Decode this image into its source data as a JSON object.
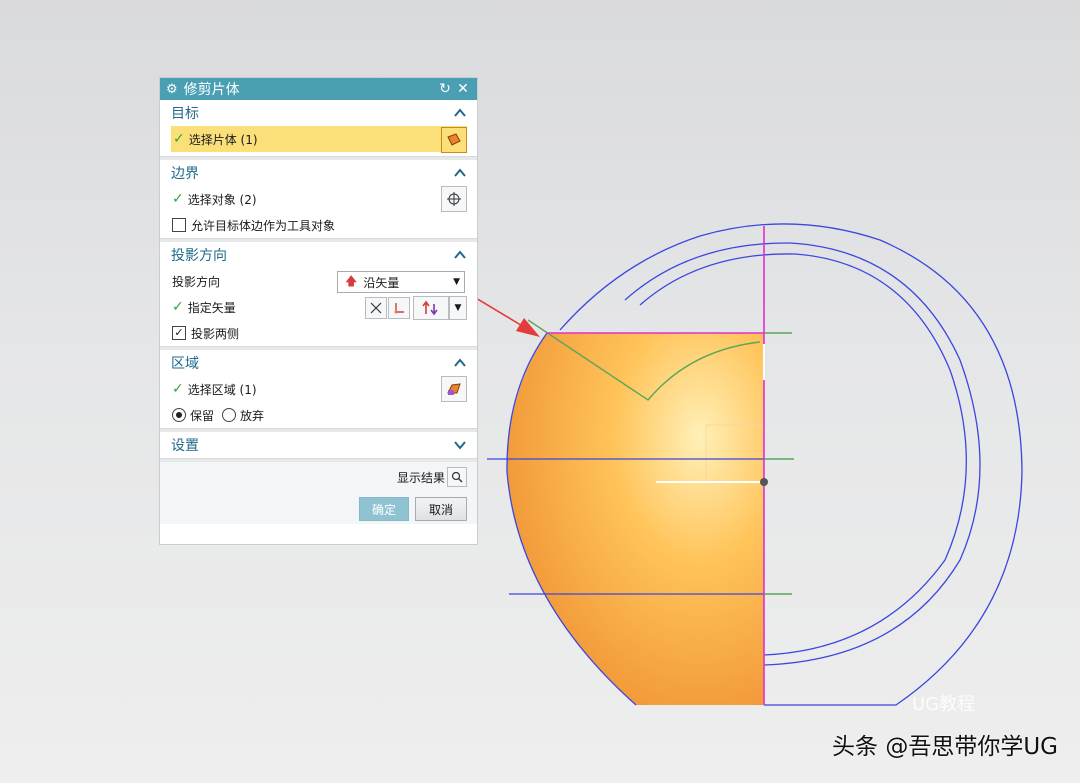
{
  "dialog": {
    "title": "修剪片体",
    "sections": {
      "target": {
        "label": "目标",
        "row_label": "选择片体 (1)"
      },
      "boundary": {
        "label": "边界",
        "row_label": "选择对象 (2)",
        "checkbox_label": "允许目标体边作为工具对象"
      },
      "projection": {
        "label": "投影方向",
        "dir_label": "投影方向",
        "dir_value": "沿矢量",
        "vector_label": "指定矢量",
        "both_sides_label": "投影两侧"
      },
      "region": {
        "label": "区域",
        "row_label": "选择区域 (1)",
        "keep_label": "保留",
        "discard_label": "放弃"
      },
      "settings": {
        "label": "设置"
      }
    },
    "preview_label": "显示结果",
    "ok_label": "确定",
    "cancel_label": "取消"
  },
  "watermark": {
    "text": "头条 @吾思带你学UG",
    "logo_text": "UG教程"
  },
  "colors": {
    "titlebar": "#4a9fb3",
    "highlight": "#fbe07a",
    "sphere": "#f7a83a",
    "curve": "#3c46e0",
    "magenta": "#e52ccf",
    "green": "#3cc23c",
    "arrow": "#e23c3c"
  },
  "icons": [
    "gear-icon",
    "reset-icon",
    "close-icon",
    "chevron-up-icon",
    "chevron-down-icon",
    "crosshair-icon",
    "sheet-body-icon",
    "region-icon",
    "magnify-icon"
  ]
}
